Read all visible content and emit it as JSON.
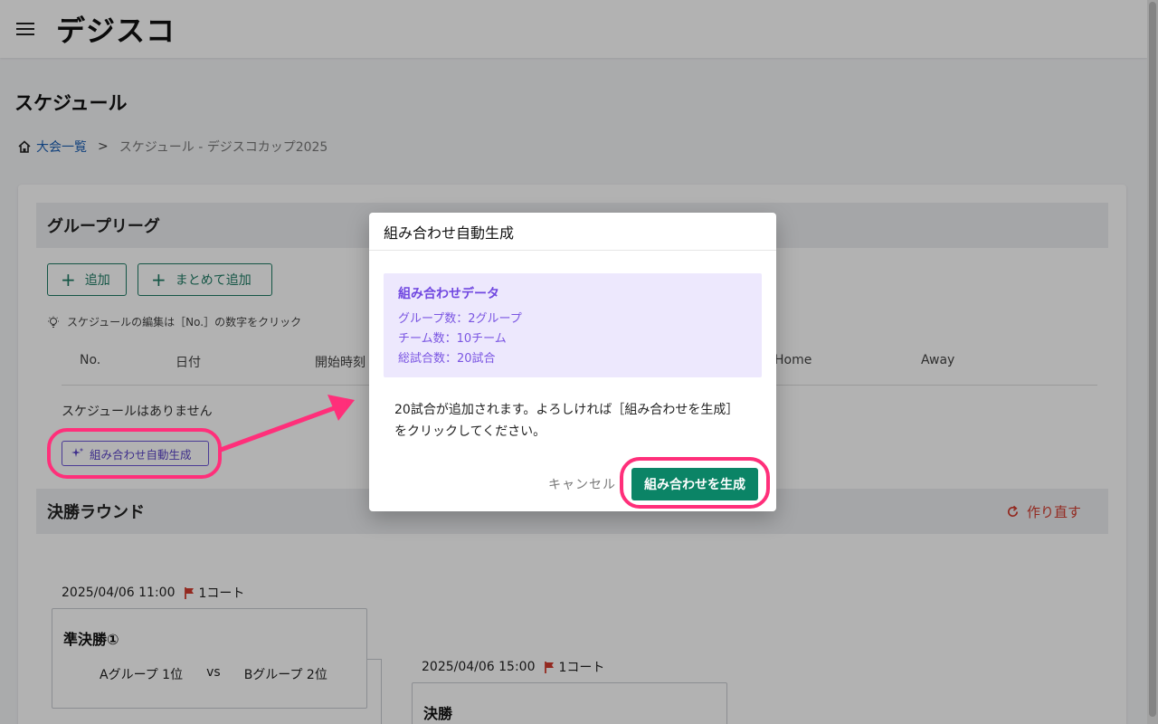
{
  "header": {
    "logo": "デジスコ"
  },
  "page": {
    "title": "スケジュール"
  },
  "breadcrumb": {
    "home": "大会一覧",
    "separator": ">",
    "current": "スケジュール - デジスコカップ2025"
  },
  "group_league": {
    "title": "グループリーグ",
    "add_label": "追加",
    "bulk_add_label": "まとめて追加",
    "hint": "スケジュールの編集は［No.］の数字をクリック",
    "columns": [
      "No.",
      "日付",
      "開始時刻",
      "Home",
      "Away"
    ],
    "empty_message": "スケジュールはありません",
    "auto_generate_label": "組み合わせ自動生成"
  },
  "final_round": {
    "title": "決勝ラウンド",
    "redo_label": "作り直す",
    "matches": [
      {
        "datetime": "2025/04/06 11:00",
        "court": "1コート",
        "name": "準決勝①",
        "home": "Aグループ 1位",
        "vs": "vs",
        "away": "Bグループ 2位"
      },
      {
        "datetime": "2025/04/06 15:00",
        "court": "1コート",
        "name": "決勝"
      }
    ]
  },
  "modal": {
    "title": "組み合わせ自動生成",
    "info_title": "組み合わせデータ",
    "info_lines": [
      "グループ数：2グループ",
      "チーム数：10チーム",
      "総試合数：20試合"
    ],
    "message_line1": "20試合が追加されます。よろしければ［組み合わせを生成］",
    "message_line2": "をクリックしてください。",
    "cancel_label": "キャンセル",
    "generate_label": "組み合わせを生成"
  },
  "colors": {
    "primary": "#0b8466",
    "accent": "#6b54d6",
    "highlight": "#ff2f7a",
    "danger": "#d33c2e"
  }
}
